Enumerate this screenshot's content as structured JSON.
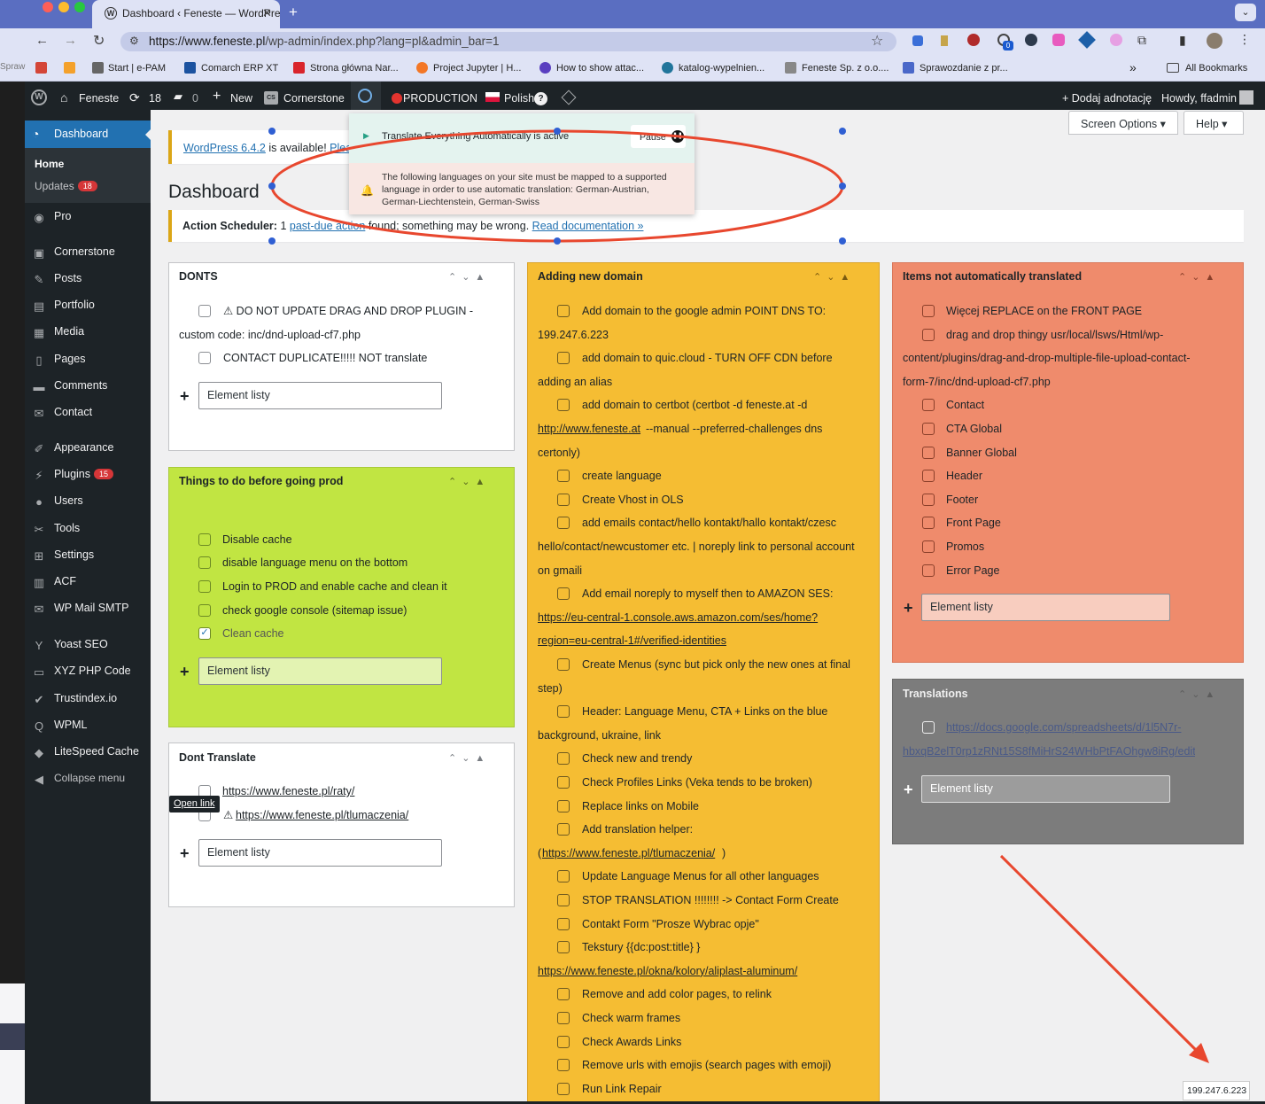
{
  "browser": {
    "tab_title": "Dashboard ‹ Feneste — WordPress",
    "url_main": "https://www.feneste.pl",
    "url_rest": "/wp-admin/index.php?lang=pl&admin_bar=1",
    "ext_badge": "0",
    "bookmarks": [
      "Start | e-PAM",
      "Comarch ERP XT",
      "Strona główna Nar...",
      "Project Jupyter | H...",
      "How to show attac...",
      "katalog-wypelnien...",
      "Feneste Sp. z o.o....",
      "Sprawozdanie z pr..."
    ],
    "more_bookmarks": "»",
    "all_bookmarks": "All Bookmarks",
    "left_partial": "Spraw"
  },
  "adminbar": {
    "site": "Feneste",
    "updates": "18",
    "comments": "0",
    "new": "New",
    "cornerstone": "Cornerstone",
    "production": "PRODUCTION",
    "language": "Polish",
    "add_note": "+ Dodaj adnotację",
    "howdy": "Howdy, ffadmin"
  },
  "sidebar": {
    "dashboard": "Dashboard",
    "home": "Home",
    "updates": "Updates",
    "updates_count": "18",
    "items": [
      {
        "label": "Pro",
        "icon": "◉"
      },
      {
        "label": "Cornerstone",
        "icon": "▣"
      },
      {
        "label": "Posts",
        "icon": "✎"
      },
      {
        "label": "Portfolio",
        "icon": "▤"
      },
      {
        "label": "Media",
        "icon": "▦"
      },
      {
        "label": "Pages",
        "icon": "▯"
      },
      {
        "label": "Comments",
        "icon": "▬"
      },
      {
        "label": "Contact",
        "icon": "✉"
      },
      {
        "label": "Appearance",
        "icon": "✐"
      },
      {
        "label": "Plugins",
        "icon": "⚡",
        "badge": "15"
      },
      {
        "label": "Users",
        "icon": "●"
      },
      {
        "label": "Tools",
        "icon": "✂"
      },
      {
        "label": "Settings",
        "icon": "⊞"
      },
      {
        "label": "ACF",
        "icon": "▥"
      },
      {
        "label": "WP Mail SMTP",
        "icon": "✉"
      },
      {
        "label": "Yoast SEO",
        "icon": "Y"
      },
      {
        "label": "XYZ PHP Code",
        "icon": "▭"
      },
      {
        "label": "Trustindex.io",
        "icon": "✔"
      },
      {
        "label": "WPML",
        "icon": "Q"
      },
      {
        "label": "LiteSpeed Cache",
        "icon": "◆"
      },
      {
        "label": "Collapse menu",
        "icon": "◀"
      }
    ]
  },
  "screen_options": "Screen Options ▾",
  "help": "Help ▾",
  "page_title": "Dashboard",
  "notice_wp": {
    "link": "WordPress 6.4.2",
    "text": " is available! ",
    "tail": "Plea"
  },
  "action_scheduler": {
    "label": "Action Scheduler:",
    "pre": " 1 ",
    "link": "past-due action",
    "post": " found; something may be wrong. ",
    "doc": "Read documentation »"
  },
  "popup": {
    "status": "Translate Everything Automatically is active",
    "pause": "Pause",
    "warning": "The following languages on your site must be mapped to a supported language in order to use automatic translation: German-Austrian, German-Liechtenstein, German-Swiss"
  },
  "add_placeholder": "Element listy",
  "panels": {
    "donts": {
      "title": "DONTS",
      "items": [
        "⚠ DO NOT UPDATE DRAG AND DROP PLUGIN -",
        "custom code: inc/dnd-upload-cf7.php",
        "CONTACT DUPLICATE!!!!! NOT translate"
      ]
    },
    "things": {
      "title": "Things to do before going prod",
      "items": [
        "Disable cache",
        "disable language menu on the bottom",
        "Login to PROD and enable cache and clean it",
        "check google console (sitemap issue)",
        "Clean cache"
      ]
    },
    "dont_translate": {
      "title": "Dont Translate",
      "items": [
        "https://www.feneste.pl/raty/",
        "https://www.feneste.pl/tlumaczenia/"
      ],
      "tooltip": "Open link"
    },
    "domain": {
      "title": "Adding new domain",
      "lines": [
        "Add domain to the google admin POINT DNS TO:",
        "199.247.6.223",
        "add domain to quic.cloud - TURN OFF CDN before",
        "adding an alias",
        "add domain to certbot (certbot -d feneste.at -d",
        "http://www.feneste.at",
        " --manual --preferred-challenges dns",
        "certonly)",
        "create language",
        "Create Vhost in OLS",
        "add emails contact/hello kontakt/hallo kontakt/czesc",
        "hello/contact/newcustomer etc. | noreply link to personal account",
        "on gmaili",
        "Add email noreply to myself then to AMAZON SES:",
        "https://eu-central-1.console.aws.amazon.com/ses/home?",
        "region=eu-central-1#/verified-identities",
        "Create Menus (sync but pick only the new ones at final",
        "step)",
        "Header: Language Menu, CTA + Links on the blue",
        "background, ukraine, link",
        "Check new and trendy",
        "Check Profiles Links (Veka tends to be broken)",
        "Replace links on Mobile",
        "Add translation helper:",
        "(",
        "https://www.feneste.pl/tlumaczenia/",
        ")",
        "Update Language Menus for all other languages",
        "STOP TRANSLATION !!!!!!!! -> Contact Form Create",
        "Contakt Form \"Prosze Wybrac opje\"",
        "Tekstury {{dc:post:title} }",
        "https://www.feneste.pl/okna/kolory/aliplast-aluminum/",
        "Remove and add color pages, to relink",
        "Check warm frames",
        "Check Awards Links",
        "Remove urls with emojis (search pages with emoji)",
        "Run Link Repair"
      ]
    },
    "not_translated": {
      "title": "Items not automatically translated",
      "lines": [
        "Więcej REPLACE on the FRONT PAGE",
        "drag and drop thingy usr/local/lsws/Html/wp-",
        "content/plugins/drag-and-drop-multiple-file-upload-contact-",
        "form-7/inc/dnd-upload-cf7.php",
        "Contact",
        "CTA Global",
        "Banner Global",
        "Header",
        "Footer",
        "Front Page",
        "Promos",
        "Error Page"
      ]
    },
    "translations": {
      "title": "Translations",
      "link1": "https://docs.google.com/spreadsheets/d/1l5N7r-",
      "link2": "hbxqB2elT0rp1zRNt15S8fMiHrS24WHbPtFAOhgw8iRg/edit"
    }
  },
  "ip_tooltip": "199.247.6.223",
  "colors": {
    "yellow": "#f5bd33",
    "green": "#c1e542",
    "salmon": "#ef8b6c",
    "gray": "#7c7c7c",
    "accent": "#2271b1",
    "annotation": "#e8472e"
  }
}
